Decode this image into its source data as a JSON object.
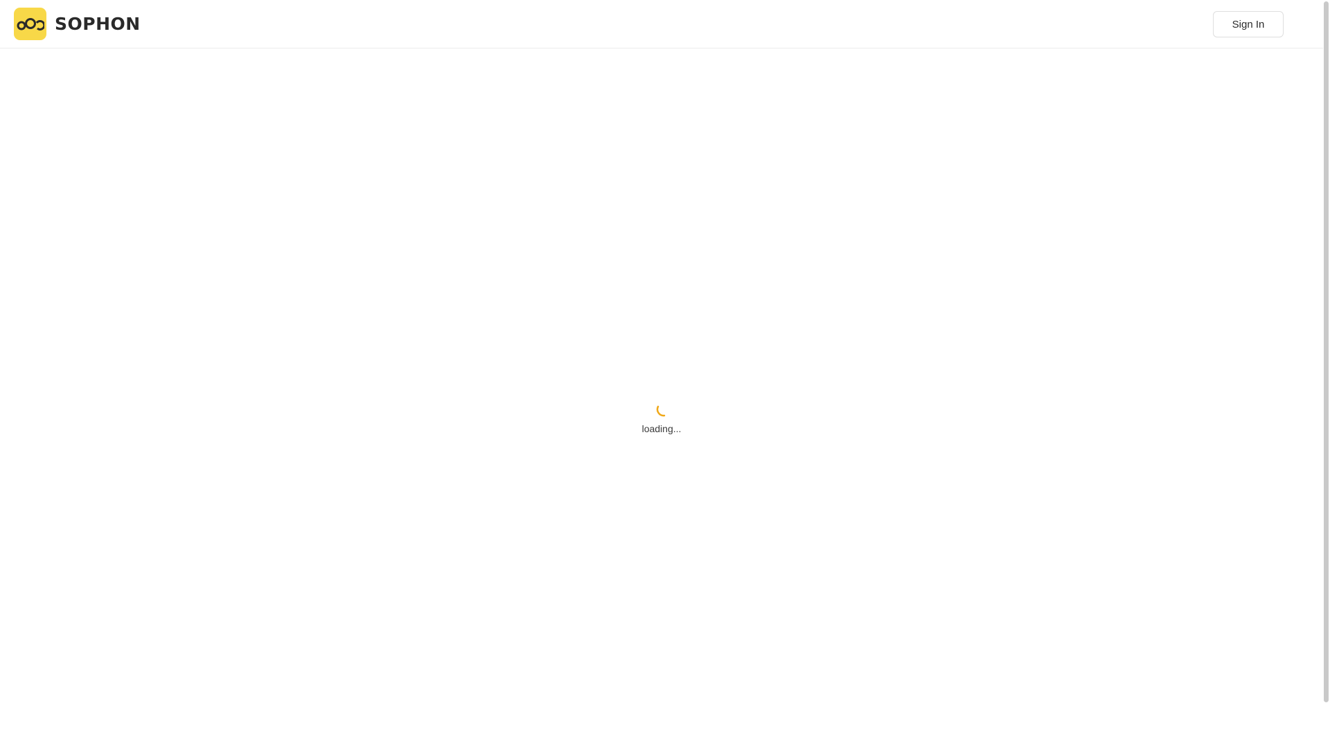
{
  "header": {
    "brand": "SOPHON",
    "logo_icon": "sophon-logo-icon",
    "signin_label": "Sign In"
  },
  "main": {
    "loading_text": "loading...",
    "spinner_icon": "spinner-icon"
  },
  "colors": {
    "brand_yellow": "#f8d848",
    "spinner": "#f0a818",
    "text": "#2a2a2a",
    "border": "#dedede"
  }
}
